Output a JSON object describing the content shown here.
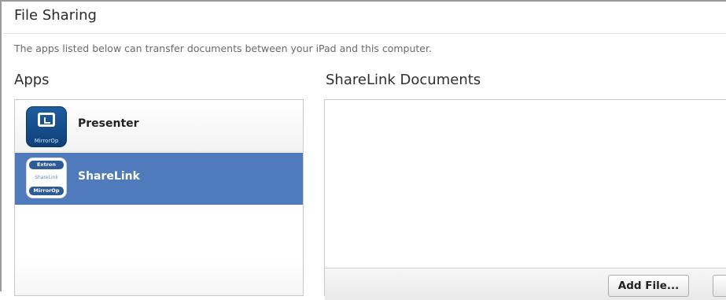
{
  "header": {
    "title": "File Sharing",
    "description": "The apps listed below can transfer documents between your iPad and this computer."
  },
  "apps": {
    "heading": "Apps",
    "items": [
      {
        "label": "Presenter",
        "icon": "presenter-app-icon",
        "icon_brand": "MirrorOp",
        "selected": false
      },
      {
        "label": "ShareLink",
        "icon": "sharelink-app-icon",
        "icon_top": "Extron",
        "icon_mid": "ShareLink",
        "icon_bottom": "MirrorOp",
        "selected": true
      }
    ]
  },
  "documents": {
    "heading": "ShareLink Documents",
    "add_file_label": "Add File..."
  },
  "colors": {
    "selection": "#4f7bbd",
    "border": "#c9c9c9"
  }
}
